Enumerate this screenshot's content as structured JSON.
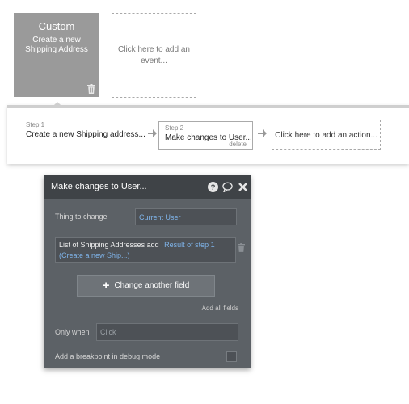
{
  "events": {
    "custom_card": {
      "type": "Custom",
      "name": "Create a new Shipping Address"
    },
    "add_event_text": "Click here to add an event..."
  },
  "workflow": {
    "step1": {
      "label": "Step 1",
      "text": "Create a new Shipping address..."
    },
    "step2": {
      "label": "Step 2",
      "text": "Make changes to User...",
      "delete": "delete"
    },
    "add_action_text": "Click here to add an action..."
  },
  "editor": {
    "title": "Make changes to User...",
    "thing_label": "Thing to change",
    "thing_value": "Current User",
    "field_text": "List of Shipping Addresses add",
    "field_value_line1": "Result of step 1",
    "field_value_line2": "(Create a new Ship...)",
    "change_button": "Change another field",
    "add_all_fields": "Add all fields",
    "only_when_label": "Only when",
    "only_when_placeholder": "Click",
    "breakpoint_label": "Add a breakpoint in debug mode"
  },
  "icons": {
    "trash": "trash-icon",
    "arrow": "arrow-right-icon",
    "help": "help-icon",
    "comment": "comment-icon",
    "close": "close-icon"
  },
  "colors": {
    "event_card": "#9a9a9a",
    "panel_bg": "#5c6166",
    "panel_header": "#3f4347",
    "link": "#7fb4ea"
  }
}
